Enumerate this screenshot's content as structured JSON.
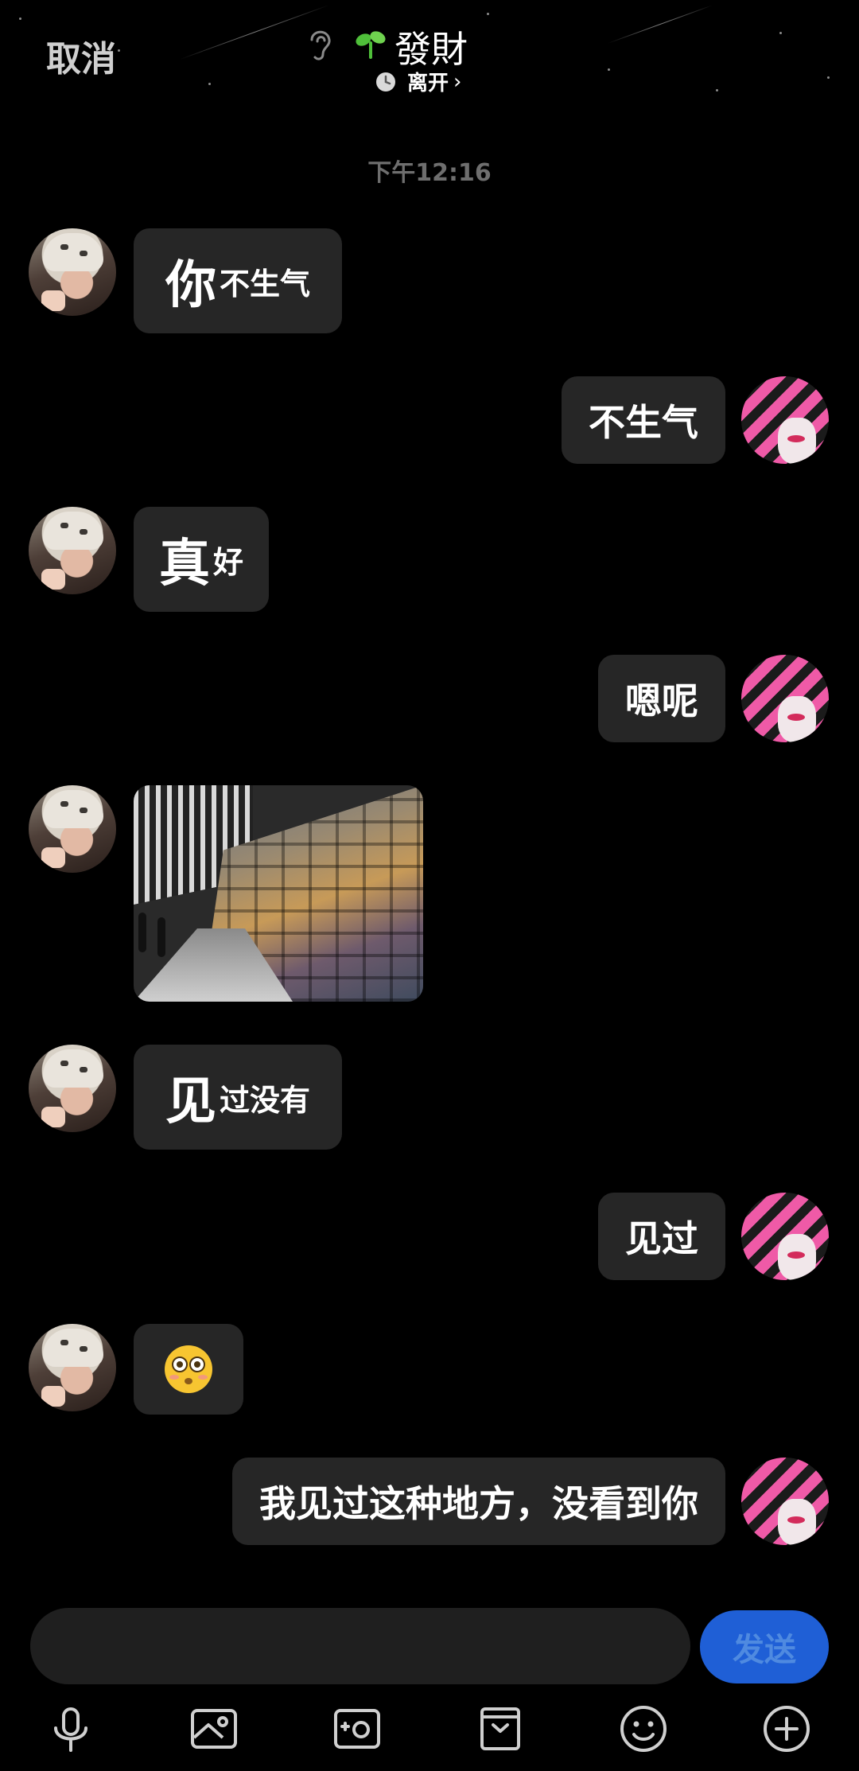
{
  "header": {
    "cancel_label": "取消",
    "contact_name": "發財",
    "status": "离开",
    "status_chevron": "›",
    "icons": [
      "ear-icon",
      "sprout-icon",
      "clock-icon",
      "chevron-right-icon"
    ]
  },
  "chat": {
    "timestamp": "下午12:16",
    "messages": [
      {
        "side": "left",
        "type": "text",
        "big": "你",
        "small": "不生气"
      },
      {
        "side": "right",
        "type": "text",
        "text": "不生气"
      },
      {
        "side": "left",
        "type": "text",
        "big": "真",
        "small": "好"
      },
      {
        "side": "right",
        "type": "text",
        "text": "嗯呢"
      },
      {
        "side": "left",
        "type": "image",
        "description_icon": "photo-wall-image"
      },
      {
        "side": "left",
        "type": "text",
        "big": "见",
        "small": "过没有"
      },
      {
        "side": "right",
        "type": "text",
        "text": "见过"
      },
      {
        "side": "left",
        "type": "emoji",
        "icon": "flushed-face-icon"
      },
      {
        "side": "right",
        "type": "text",
        "text": "我见过这种地方，没看到你"
      }
    ]
  },
  "composer": {
    "input_value": "",
    "send_label": "发送",
    "accent_color": "#1f5fd6"
  },
  "toolbar": {
    "icons": [
      "microphone-icon",
      "image-icon",
      "camera-icon",
      "bag-icon",
      "smile-icon",
      "plus-icon"
    ]
  }
}
